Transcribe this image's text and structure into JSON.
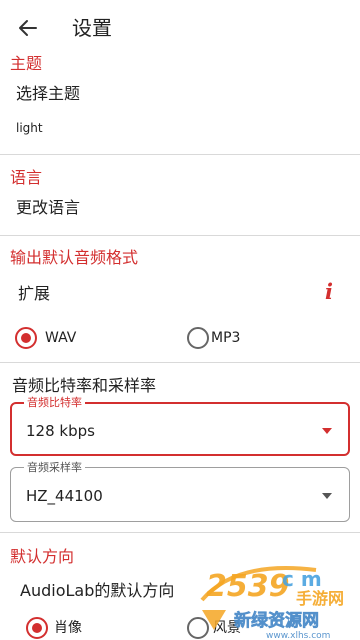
{
  "header": {
    "title": "设置",
    "back_icon": "arrow-left-icon"
  },
  "theme": {
    "title": "主题",
    "item": "选择主题",
    "value": "light"
  },
  "language": {
    "title": "语言",
    "item": "更改语言"
  },
  "output": {
    "title": "输出默认音频格式",
    "extension_label": "扩展",
    "info_icon": "info-icon",
    "formats": [
      {
        "label": "WAV",
        "selected": true
      },
      {
        "label": "MP3",
        "selected": false
      }
    ]
  },
  "audio": {
    "title": "音频比特率和采样率",
    "bitrate": {
      "label": "音频比特率",
      "value": "128 kbps"
    },
    "samplerate": {
      "label": "音频采样率",
      "value": "HZ_44100"
    }
  },
  "orientation": {
    "title": "默认方向",
    "subtitle": "AudioLab的默认方向",
    "options": [
      {
        "label": "肖像",
        "selected": true
      },
      {
        "label": "风景",
        "selected": false
      }
    ]
  },
  "watermark": {
    "logo": "2539",
    "suffix": "c m",
    "site": "手游网",
    "tagline": "新绿资源网",
    "url": "www.xlhs.com"
  },
  "colors": {
    "accent": "#d32f2f",
    "text": "#222222",
    "divider": "#d9d9d9"
  }
}
